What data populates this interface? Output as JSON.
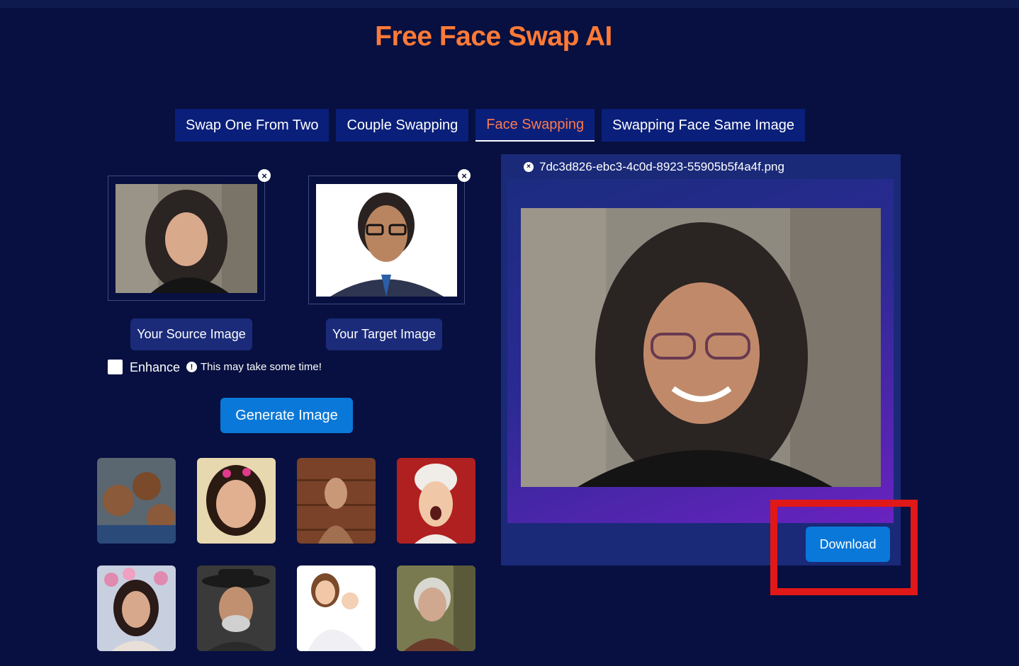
{
  "header": {
    "title": "Free Face Swap AI"
  },
  "tabs": [
    {
      "label": "Swap One From Two",
      "active": false
    },
    {
      "label": "Couple Swapping",
      "active": false
    },
    {
      "label": "Face Swapping",
      "active": true
    },
    {
      "label": "Swapping Face Same Image",
      "active": false
    }
  ],
  "source": {
    "button_label": "Your Source Image",
    "close_glyph": "×"
  },
  "target": {
    "button_label": "Your Target Image",
    "close_glyph": "×"
  },
  "options": {
    "enhance_label": "Enhance",
    "enhance_checked": false,
    "info_glyph": "!",
    "note": "This may take some time!"
  },
  "actions": {
    "generate_label": "Generate Image"
  },
  "result": {
    "filename": "7dc3d826-ebc3-4c0d-8923-55905b5f4a4f.png",
    "close_glyph": "×",
    "download_label": "Download"
  },
  "colors": {
    "background": "#071040",
    "title": "#ff7a36",
    "tab": "#0a1f7a",
    "active_tab_text": "#ff7a4e",
    "primary_button": "#0a78d8",
    "highlight": "#e01818"
  }
}
